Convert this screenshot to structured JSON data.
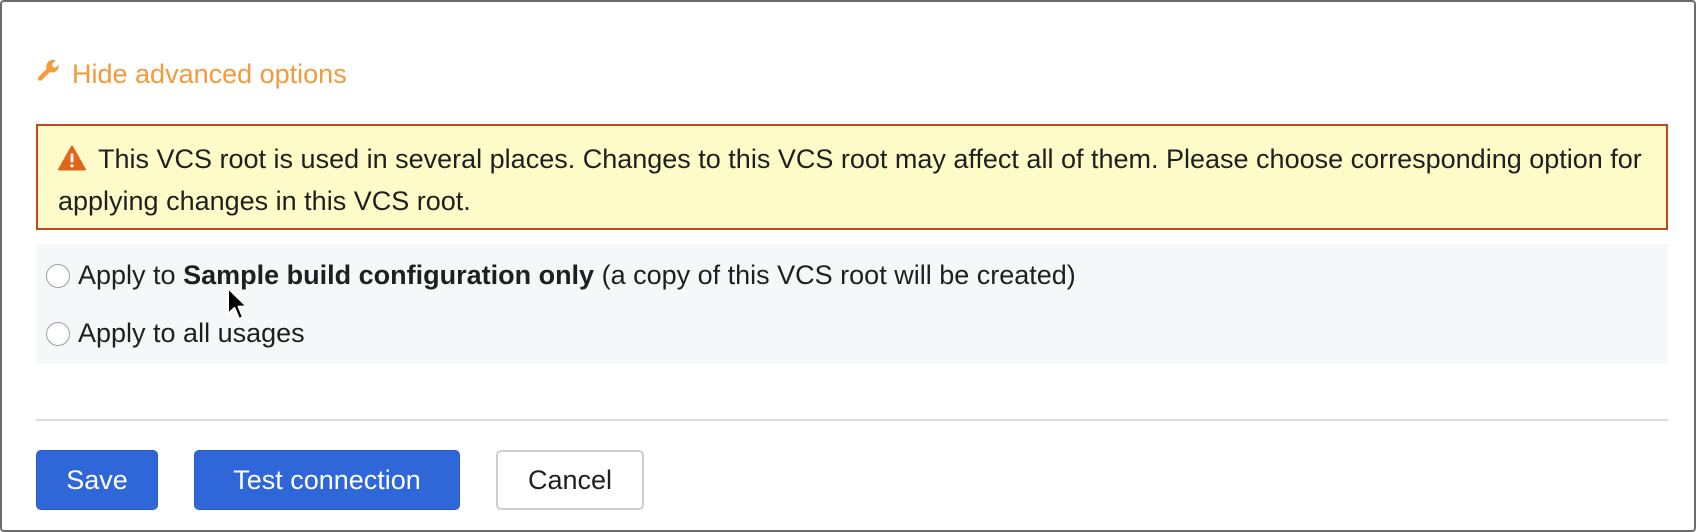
{
  "advanced_toggle": {
    "label": "Hide advanced options",
    "icon": "wrench-icon",
    "color": "#f39a3a"
  },
  "warning": {
    "icon": "warning-icon",
    "text": "This VCS root is used in several places. Changes to this VCS root may affect all of them. Please choose corresponding option for applying changes in this VCS root."
  },
  "options": [
    {
      "prefix": "Apply to ",
      "bold": "Sample build configuration only",
      "suffix": " (a copy of this VCS root will be created)",
      "selected": false
    },
    {
      "prefix": "Apply to all usages",
      "bold": "",
      "suffix": "",
      "selected": false
    }
  ],
  "actions": {
    "save_label": "Save",
    "test_label": "Test connection",
    "cancel_label": "Cancel",
    "primary_color": "#2f66d8"
  }
}
